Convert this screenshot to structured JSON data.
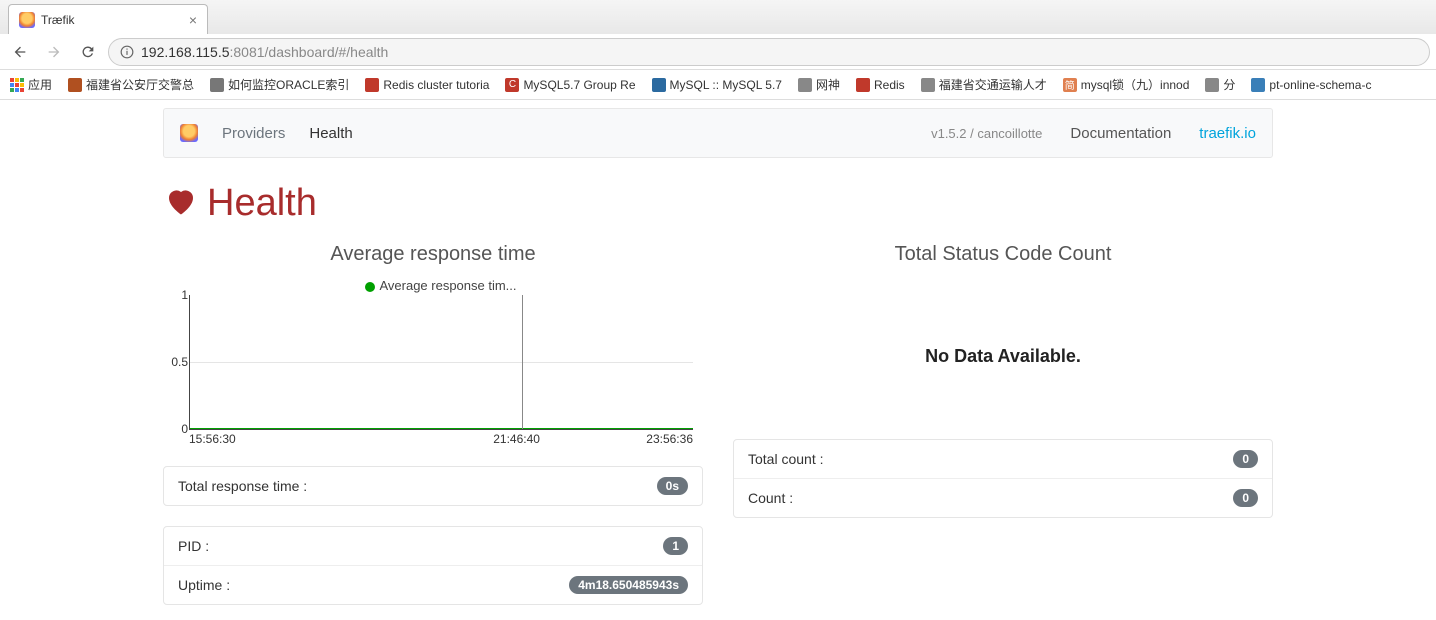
{
  "tab": {
    "title": "Træfik"
  },
  "toolbar": {
    "url_host": "192.168.115.5",
    "url_port": ":8081",
    "url_path": "/dashboard/#/health"
  },
  "bookmarks": {
    "apps": "应用",
    "items": [
      {
        "label": "福建省公安厅交警总",
        "color": "#b05020"
      },
      {
        "label": "如何监控ORACLE索引",
        "color": "#777"
      },
      {
        "label": "Redis cluster tutoria",
        "color": "#c0392b"
      },
      {
        "label": "MySQL5.7 Group Re",
        "color": "#c0392b"
      },
      {
        "label": "MySQL :: MySQL 5.7",
        "color": "#2b6aa0"
      },
      {
        "label": "网神",
        "color": "#888"
      },
      {
        "label": "Redis",
        "color": "#c0392b"
      },
      {
        "label": "福建省交通运输人才",
        "color": "#888"
      },
      {
        "label": "mysql锁（九）innod",
        "color": "#e08050"
      },
      {
        "label": "分",
        "color": "#888"
      },
      {
        "label": "pt-online-schema-c",
        "color": "#3a7fb8"
      }
    ]
  },
  "navbar": {
    "providers": "Providers",
    "health": "Health",
    "version": "v1.5.2 / cancoillotte",
    "documentation": "Documentation",
    "traefik_io": "traefik.io"
  },
  "header": {
    "title": "Health"
  },
  "chart_left": {
    "title": "Average response time",
    "legend": "Average response tim..."
  },
  "chart_right": {
    "title": "Total Status Code Count",
    "no_data": "No Data Available."
  },
  "chart_data": {
    "type": "line",
    "title": "Average response time",
    "series": [
      {
        "name": "Average response time",
        "values": [
          0.0,
          0.0,
          0.0
        ]
      }
    ],
    "x": [
      "15:56:30",
      "21:46:40",
      "23:56:36"
    ],
    "ylabel": "",
    "xlabel": "",
    "ylim": [
      0.0,
      1.0
    ],
    "y_ticks": [
      0.0,
      0.5,
      1.0
    ],
    "x_ticks": [
      "15:56:30",
      "21:46:40",
      "23:56:36"
    ]
  },
  "left_stats": {
    "total_response_time": {
      "label": "Total response time :",
      "value": "0s"
    },
    "pid": {
      "label": "PID :",
      "value": "1"
    },
    "uptime": {
      "label": "Uptime :",
      "value": "4m18.650485943s"
    }
  },
  "right_stats": {
    "total_count": {
      "label": "Total count :",
      "value": "0"
    },
    "count": {
      "label": "Count :",
      "value": "0"
    }
  }
}
